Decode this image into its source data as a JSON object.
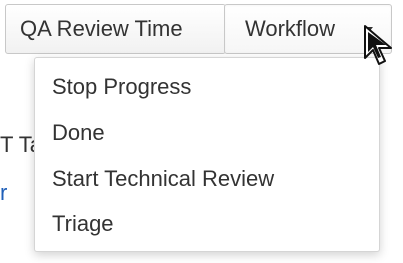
{
  "toolbar": {
    "qa_review_time_label": "QA Review Time",
    "workflow_label": "Workflow"
  },
  "background": {
    "fragment_text": "T Ta",
    "fragment_link": "r"
  },
  "workflow_menu": {
    "items": [
      {
        "label": "Stop Progress"
      },
      {
        "label": "Done"
      },
      {
        "label": "Start Technical Review"
      },
      {
        "label": "Triage"
      }
    ]
  },
  "icons": {
    "caret": "chevron-down-icon",
    "cursor": "mouse-pointer-icon"
  },
  "colors": {
    "button_border": "#c8c8c8",
    "menu_border": "#d5d5d5",
    "text": "#333333",
    "link": "#1f5fb8"
  }
}
